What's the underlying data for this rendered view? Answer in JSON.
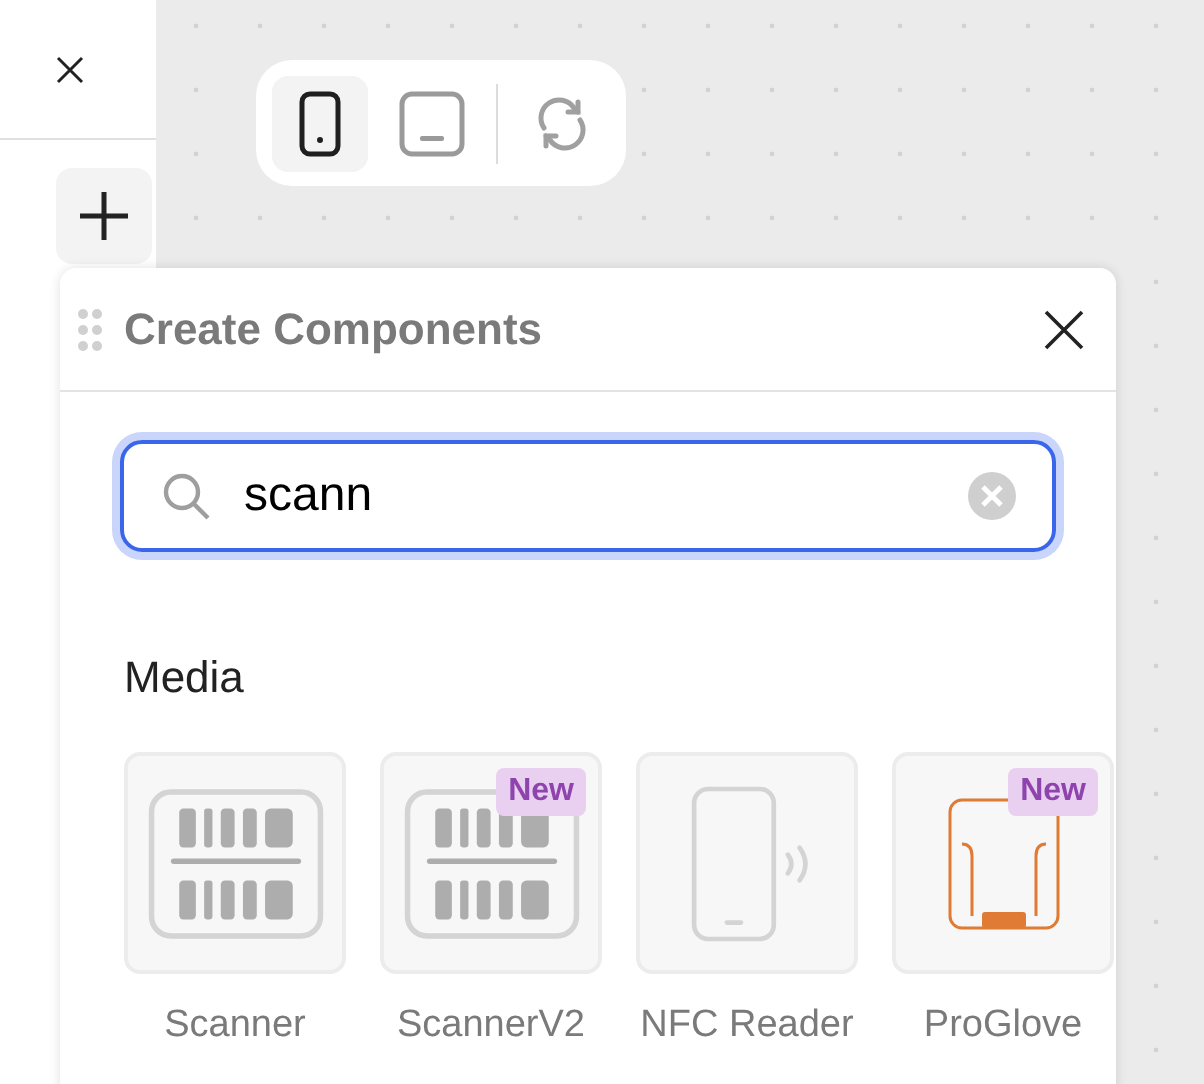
{
  "device_toolbar": {
    "devices": [
      {
        "kind": "portrait",
        "selected": true
      },
      {
        "kind": "landscape",
        "selected": false
      }
    ]
  },
  "panel": {
    "title": "Create Components",
    "search": {
      "value": "scann"
    },
    "sections": [
      {
        "title": "Media",
        "items": [
          {
            "kind": "scanner",
            "label": "Scanner"
          },
          {
            "kind": "scanner",
            "label": "ScannerV2",
            "badge": "New"
          },
          {
            "kind": "nfc",
            "label": "NFC Reader"
          },
          {
            "kind": "glove",
            "label": "ProGlove",
            "badge": "New"
          }
        ]
      }
    ]
  }
}
